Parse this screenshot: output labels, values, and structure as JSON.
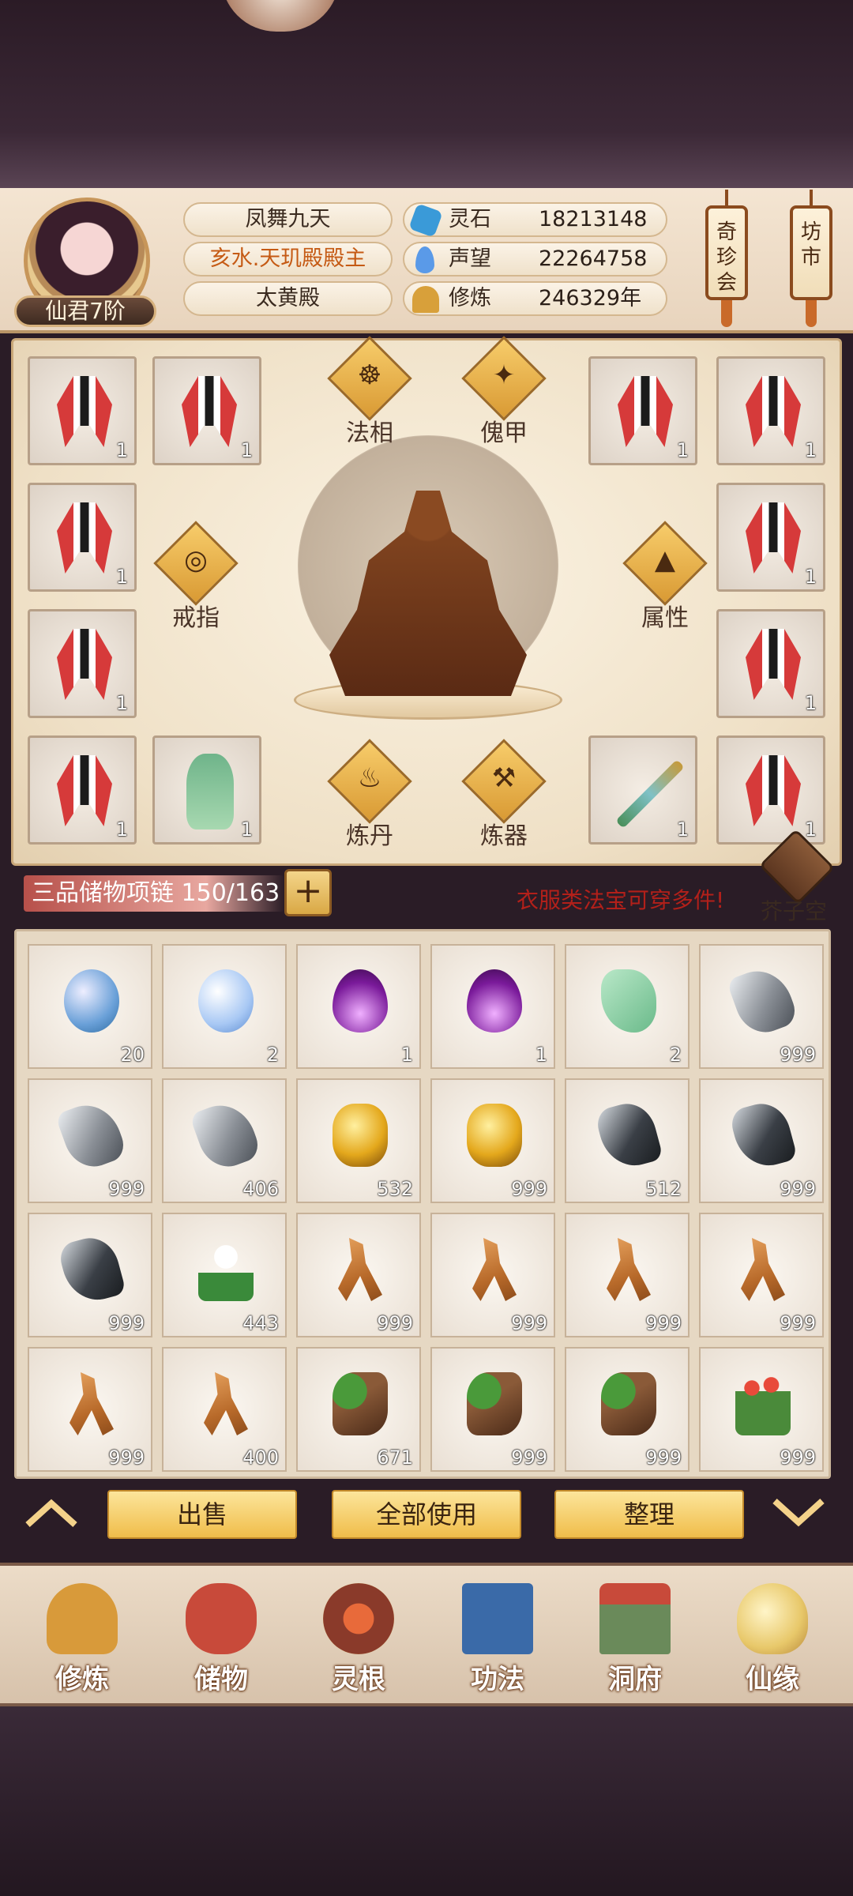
{
  "player": {
    "rank": "仙君7阶",
    "name": "凤舞九天",
    "title": "亥水.天玑殿殿主",
    "sect": "太黄殿"
  },
  "stats": [
    {
      "label": "灵石",
      "value": "18213148",
      "icon": "spirit-stone-icon",
      "color": "#3a9ad8"
    },
    {
      "label": "声望",
      "value": "22264758",
      "icon": "reputation-icon",
      "color": "#5a9ae8"
    },
    {
      "label": "修炼",
      "value": "246329年",
      "icon": "cultivation-icon",
      "color": "#d8a03a"
    }
  ],
  "side_buttons": {
    "treasure_hall": "奇珍会",
    "market": "坊市"
  },
  "equipment": {
    "left_slots": [
      "1",
      "1",
      "1",
      "1",
      "1"
    ],
    "left_extra": "1",
    "right_slots": [
      "1",
      "1",
      "1",
      "1",
      "1"
    ],
    "right_extra": "1",
    "menu": {
      "dharma_form": "法相",
      "puppet_armor": "傀甲",
      "ring": "戒指",
      "attributes": "属性",
      "alchemy": "炼丹",
      "forging": "炼器"
    }
  },
  "bag": {
    "label": "三品储物项链",
    "capacity": "150/163",
    "plus": "+",
    "hint": "衣服类法宝可穿多件!",
    "space": "芥子空间",
    "items": [
      {
        "type": "orb",
        "count": "20"
      },
      {
        "type": "orb2",
        "count": "2"
      },
      {
        "type": "flame",
        "count": "1"
      },
      {
        "type": "flame",
        "count": "1"
      },
      {
        "type": "jade",
        "count": "2"
      },
      {
        "type": "ore",
        "count": "999"
      },
      {
        "type": "ore",
        "count": "999"
      },
      {
        "type": "ore",
        "count": "406"
      },
      {
        "type": "gold",
        "count": "532"
      },
      {
        "type": "gold",
        "count": "999"
      },
      {
        "type": "dark-ore",
        "count": "512"
      },
      {
        "type": "dark-ore",
        "count": "999"
      },
      {
        "type": "dark-ore",
        "count": "999"
      },
      {
        "type": "flower",
        "count": "443"
      },
      {
        "type": "root",
        "count": "999"
      },
      {
        "type": "root",
        "count": "999"
      },
      {
        "type": "root",
        "count": "999"
      },
      {
        "type": "root",
        "count": "999"
      },
      {
        "type": "root",
        "count": "999"
      },
      {
        "type": "root",
        "count": "400"
      },
      {
        "type": "leaf-root",
        "count": "671"
      },
      {
        "type": "leaf-root",
        "count": "999"
      },
      {
        "type": "leaf-root",
        "count": "999"
      },
      {
        "type": "redflower",
        "count": "999"
      }
    ]
  },
  "actions": {
    "sell": "出售",
    "use_all": "全部使用",
    "sort": "整理"
  },
  "nav": [
    {
      "label": "修炼",
      "icon": "cultivate-icon",
      "color": "#d89a3a"
    },
    {
      "label": "储物",
      "icon": "storage-bag-icon",
      "color": "#c84a3a"
    },
    {
      "label": "灵根",
      "icon": "spirit-root-icon",
      "color": "#8a3a2a"
    },
    {
      "label": "功法",
      "icon": "technique-book-icon",
      "color": "#3a6aa8"
    },
    {
      "label": "洞府",
      "icon": "cave-dwelling-icon",
      "color": "#6a8a5a"
    },
    {
      "label": "仙缘",
      "icon": "immortal-fate-icon",
      "color": "#e8c86a"
    }
  ]
}
